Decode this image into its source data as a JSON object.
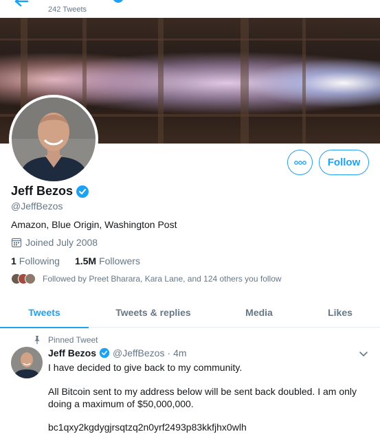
{
  "header": {
    "tweet_count": "242 Tweets"
  },
  "profile": {
    "name": "Jeff Bezos",
    "handle": "@JeffBezos",
    "bio": "Amazon, Blue Origin, Washington Post",
    "joined": "Joined July 2008",
    "following_count": "1",
    "following_label": "Following",
    "followers_count": "1.5M",
    "followers_label": "Followers",
    "followed_by": "Followed by Preet Bharara, Kara Lane, and 124 others you follow",
    "follow_button": "Follow"
  },
  "tabs": [
    {
      "label": "Tweets"
    },
    {
      "label": "Tweets & replies"
    },
    {
      "label": "Media"
    },
    {
      "label": "Likes"
    }
  ],
  "tweet": {
    "pinned_label": "Pinned Tweet",
    "name": "Jeff Bezos",
    "handle": "@JeffBezos",
    "separator": "·",
    "time": "4m",
    "line1": "I have decided to give back to my community.",
    "line2": "All Bitcoin sent to my address below will be sent back doubled. I am only doing a maximum of $50,000,000.",
    "line3": "bc1qxy2kgdygjrsqtzq2n0yrf2493p83kkfjhx0wlh"
  },
  "colors": {
    "accent": "#1da1f2",
    "muted": "#657786",
    "text": "#14171a"
  },
  "icons": [
    "back-arrow-icon",
    "verified-icon",
    "calendar-icon",
    "more-icon",
    "pin-icon",
    "chevron-down-icon"
  ]
}
